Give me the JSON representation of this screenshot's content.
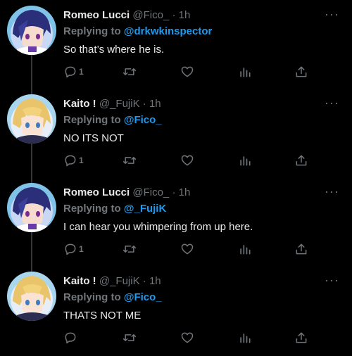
{
  "tweets": [
    {
      "name": "Romeo Lucci",
      "handle": "@Fico_",
      "dot": "·",
      "time": "1h",
      "replying_label": "Replying to",
      "mention": "@drkwkinspector",
      "text": "So that’s where he is.",
      "reply_count": "1",
      "avatar": "avatar-blue-hair"
    },
    {
      "name": "Kaito !",
      "handle": "@_FujiK",
      "dot": "·",
      "time": "1h",
      "replying_label": "Replying to",
      "mention": "@Fico_",
      "text": "NO ITS NOT",
      "reply_count": "1",
      "avatar": "avatar-blond-hair"
    },
    {
      "name": "Romeo Lucci",
      "handle": "@Fico_",
      "dot": "·",
      "time": "1h",
      "replying_label": "Replying to",
      "mention": "@_FujiK",
      "text": "I can hear you whimpering from up here.",
      "reply_count": "1",
      "avatar": "avatar-blue-hair"
    },
    {
      "name": "Kaito !",
      "handle": "@_FujiK",
      "dot": "·",
      "time": "1h",
      "replying_label": "Replying to",
      "mention": "@Fico_",
      "text": "THATS NOT ME",
      "reply_count": "",
      "avatar": "avatar-blond-hair"
    }
  ],
  "more_icon": "···",
  "colors": {
    "background": "#000000",
    "text": "#e7e9ea",
    "muted": "#71767b",
    "mention": "#1d9bf0",
    "thread_line": "#333639"
  }
}
